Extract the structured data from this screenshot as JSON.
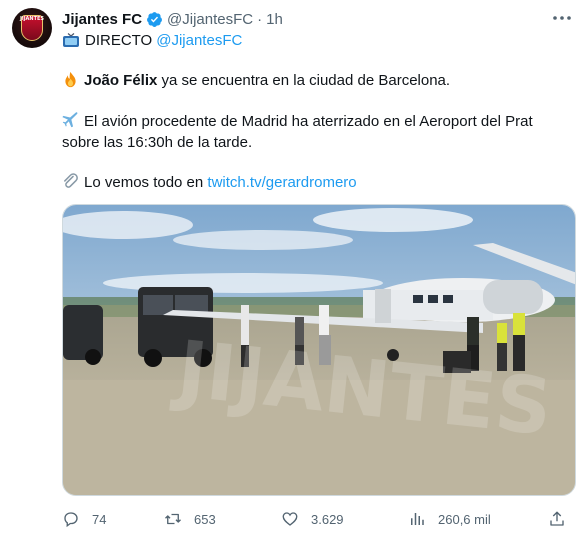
{
  "tweet": {
    "author_name": "Jijantes FC",
    "avatar_text": "JIJANTES",
    "handle": "@JijantesFC",
    "separator": "·",
    "time": "1h",
    "live_label": "DIRECTO",
    "live_mention": "@JijantesFC",
    "line1_bold": "João Félix",
    "line1_rest": "ya se encuentra en la ciudad de Barcelona.",
    "line2a": "El avión procedente de Madrid ha aterrizado en el Aeroport del Prat",
    "line2b": "sobre las 16:30h de la tarde.",
    "line3_text": "Lo vemos todo en",
    "line3_link": "twitch.tv/gerardromero",
    "image_watermark": "JIJANTES"
  },
  "actions": {
    "replies": "74",
    "retweets": "653",
    "likes": "3.629",
    "views": "260,6 mil"
  },
  "colors": {
    "accent": "#1d9bf0",
    "text": "#0f1419",
    "muted": "#536471",
    "verified": "#1d9bf0"
  },
  "icons": [
    "more-icon",
    "verified-icon",
    "tv-icon",
    "fire-icon",
    "airplane-icon",
    "paperclip-icon",
    "reply-icon",
    "retweet-icon",
    "like-icon",
    "views-icon",
    "share-icon"
  ]
}
